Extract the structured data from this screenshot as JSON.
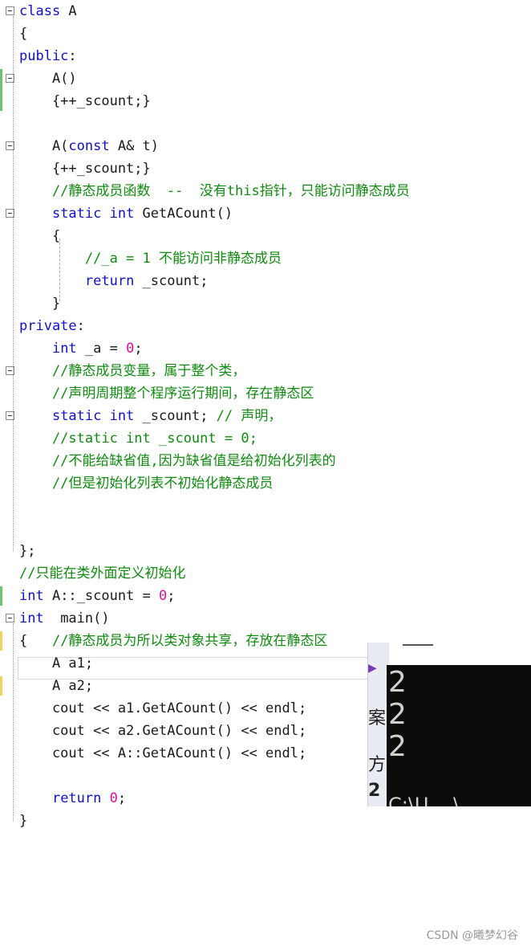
{
  "code_lines": [
    {
      "parts": [
        {
          "t": "class",
          "c": "kw"
        },
        {
          "t": " A",
          "c": ""
        }
      ]
    },
    {
      "parts": [
        {
          "t": "{",
          "c": ""
        }
      ]
    },
    {
      "parts": [
        {
          "t": "public",
          "c": "kw"
        },
        {
          "t": ":",
          "c": ""
        }
      ]
    },
    {
      "parts": [
        {
          "t": "    A()",
          "c": ""
        }
      ]
    },
    {
      "parts": [
        {
          "t": "    {++_scount;}",
          "c": ""
        }
      ]
    },
    {
      "parts": [
        {
          "t": "",
          "c": ""
        }
      ]
    },
    {
      "parts": [
        {
          "t": "    A(",
          "c": ""
        },
        {
          "t": "const",
          "c": "kw"
        },
        {
          "t": " A& t)",
          "c": ""
        }
      ]
    },
    {
      "parts": [
        {
          "t": "    {++_scount;}",
          "c": ""
        }
      ]
    },
    {
      "parts": [
        {
          "t": "    //静态成员函数  --  没有this指针，只能访问静态成员",
          "c": "cm"
        }
      ]
    },
    {
      "parts": [
        {
          "t": "    ",
          "c": ""
        },
        {
          "t": "static int",
          "c": "kw"
        },
        {
          "t": " GetACount()",
          "c": ""
        }
      ]
    },
    {
      "parts": [
        {
          "t": "    {",
          "c": ""
        }
      ]
    },
    {
      "parts": [
        {
          "t": "        //_a = 1 不能访问非静态成员",
          "c": "cm"
        }
      ]
    },
    {
      "parts": [
        {
          "t": "        ",
          "c": ""
        },
        {
          "t": "return",
          "c": "kw"
        },
        {
          "t": " _scount;",
          "c": ""
        }
      ]
    },
    {
      "parts": [
        {
          "t": "    }",
          "c": ""
        }
      ]
    },
    {
      "parts": [
        {
          "t": "private",
          "c": "kw"
        },
        {
          "t": ":",
          "c": ""
        }
      ]
    },
    {
      "parts": [
        {
          "t": "    ",
          "c": ""
        },
        {
          "t": "int",
          "c": "kw"
        },
        {
          "t": " _a = ",
          "c": ""
        },
        {
          "t": "0",
          "c": "num"
        },
        {
          "t": ";",
          "c": ""
        }
      ]
    },
    {
      "parts": [
        {
          "t": "    //静态成员变量，属于整个类，",
          "c": "cm"
        }
      ]
    },
    {
      "parts": [
        {
          "t": "    //声明周期整个程序运行期间，存在静态区",
          "c": "cm"
        }
      ]
    },
    {
      "parts": [
        {
          "t": "    ",
          "c": ""
        },
        {
          "t": "static int",
          "c": "kw"
        },
        {
          "t": " _scount; ",
          "c": ""
        },
        {
          "t": "// 声明，",
          "c": "cm"
        }
      ]
    },
    {
      "parts": [
        {
          "t": "    //static int _scount = 0;",
          "c": "cm"
        }
      ]
    },
    {
      "parts": [
        {
          "t": "    //不能给缺省值,因为缺省值是给初始化列表的",
          "c": "cm"
        }
      ]
    },
    {
      "parts": [
        {
          "t": "    //但是初始化列表不初始化静态成员",
          "c": "cm"
        }
      ]
    },
    {
      "parts": [
        {
          "t": "",
          "c": ""
        }
      ]
    },
    {
      "parts": [
        {
          "t": "",
          "c": ""
        }
      ]
    },
    {
      "parts": [
        {
          "t": "};",
          "c": ""
        }
      ]
    },
    {
      "parts": [
        {
          "t": "//只能在类外面定义初始化",
          "c": "cm"
        }
      ]
    },
    {
      "parts": [
        {
          "t": "int",
          "c": "kw"
        },
        {
          "t": " A::_scount = ",
          "c": ""
        },
        {
          "t": "0",
          "c": "num"
        },
        {
          "t": ";",
          "c": ""
        }
      ]
    },
    {
      "parts": [
        {
          "t": "int",
          "c": "kw"
        },
        {
          "t": "  main()",
          "c": ""
        }
      ]
    },
    {
      "parts": [
        {
          "t": "{   ",
          "c": ""
        },
        {
          "t": "//静态成员为所以类对象共享，存放在静态区",
          "c": "cm"
        }
      ]
    },
    {
      "parts": [
        {
          "t": "    A a1;",
          "c": ""
        }
      ]
    },
    {
      "parts": [
        {
          "t": "    A a2;",
          "c": ""
        }
      ]
    },
    {
      "parts": [
        {
          "t": "    cout << a1.GetACount() << endl;",
          "c": ""
        }
      ]
    },
    {
      "parts": [
        {
          "t": "    cout << a2.GetACount() << endl;",
          "c": ""
        }
      ]
    },
    {
      "parts": [
        {
          "t": "    cout << A::GetACount() << endl;",
          "c": ""
        }
      ]
    },
    {
      "parts": [
        {
          "t": "",
          "c": ""
        }
      ]
    },
    {
      "parts": [
        {
          "t": "    ",
          "c": ""
        },
        {
          "t": "return",
          "c": "kw"
        },
        {
          "t": " ",
          "c": ""
        },
        {
          "t": "0",
          "c": "num"
        },
        {
          "t": ";",
          "c": ""
        }
      ]
    },
    {
      "parts": [
        {
          "t": "}",
          "c": ""
        }
      ]
    }
  ],
  "console": {
    "outputs": [
      "2",
      "2",
      "2"
    ],
    "cut_line": "C:\\U    \\"
  },
  "side_panel": {
    "glyphs": [
      "▶",
      "案",
      "方案",
      "2"
    ]
  },
  "watermark": "CSDN @曦梦幻谷",
  "colors": {
    "keyword": "#1010c8",
    "comment": "#108a10",
    "number": "#e0109a",
    "console_bg": "#0c0c0c"
  }
}
